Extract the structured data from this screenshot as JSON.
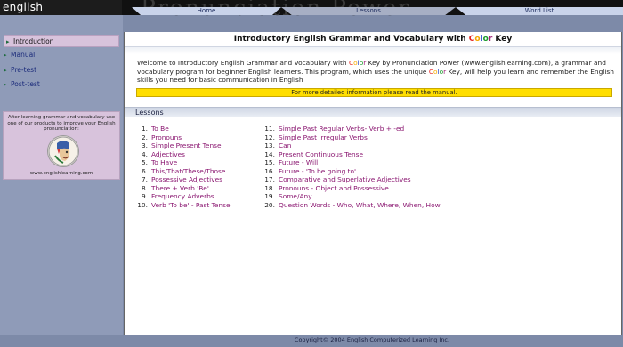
{
  "app": {
    "logo": "english Learning.com",
    "watermark": "Pronunciation Power"
  },
  "tabs": {
    "home": "Home",
    "lessons": "Lessons",
    "word_list": "Word List"
  },
  "sidebar": {
    "items": [
      "Introduction",
      "Manual",
      "Pre-test",
      "Post-test"
    ],
    "promo_text": "After learning grammar and vocabulary use one of our products to improve your English pronunciation:",
    "promo_url": "www.englishlearning.com"
  },
  "main": {
    "title_prefix": "Introductory English Grammar and Vocabulary with ",
    "title_key": "Key",
    "intro_part1": "Welcome to Introductory English Grammar and Vocabulary with ",
    "intro_part2": " Key by Pronunciation Power (www.englishlearning.com), a grammar and vocabulary program for beginner English learners.  This program, which uses the unique ",
    "intro_part3": " Key, will help you learn and remember the English skills you need for basic communication in English",
    "manual_notice": "For more detailed information please read the manual.",
    "lessons_header": "Lessons",
    "color_word": [
      "C",
      "o",
      "l",
      "o",
      "r"
    ]
  },
  "lessons_left": [
    {
      "num": "1.",
      "title": "To Be"
    },
    {
      "num": "2.",
      "title": "Pronouns"
    },
    {
      "num": "3.",
      "title": "Simple Present Tense"
    },
    {
      "num": "4.",
      "title": "Adjectives"
    },
    {
      "num": "5.",
      "title": "To Have"
    },
    {
      "num": "6.",
      "title": "This/That/These/Those"
    },
    {
      "num": "7.",
      "title": "Possessive Adjectives"
    },
    {
      "num": "8.",
      "title": "There + Verb 'Be'"
    },
    {
      "num": "9.",
      "title": "Frequency Adverbs"
    },
    {
      "num": "10.",
      "title": "Verb 'To be' - Past Tense"
    }
  ],
  "lessons_right": [
    {
      "num": "11.",
      "title": "Simple Past Regular Verbs- Verb + -ed"
    },
    {
      "num": "12.",
      "title": "Simple Past Irregular Verbs"
    },
    {
      "num": "13.",
      "title": "Can"
    },
    {
      "num": "14.",
      "title": "Present Continuous Tense"
    },
    {
      "num": "15.",
      "title": "Future - Will"
    },
    {
      "num": "16.",
      "title": "Future - 'To be going to'"
    },
    {
      "num": "17.",
      "title": "Comparative and Superlative Adjectives"
    },
    {
      "num": "18.",
      "title": "Pronouns - Object and Possessive"
    },
    {
      "num": "19.",
      "title": "Some/Any"
    },
    {
      "num": "20.",
      "title": "Question Words - Who, What, Where, When, How"
    }
  ],
  "footer": "Copyright© 2004 English Computerized Learning Inc.",
  "colors": {
    "top_bar": "#111111",
    "sidebar": "#8f9bb8",
    "highlight": "#d8c3dc",
    "notice": "#ffde00",
    "lesson_link": "#8a1670"
  }
}
